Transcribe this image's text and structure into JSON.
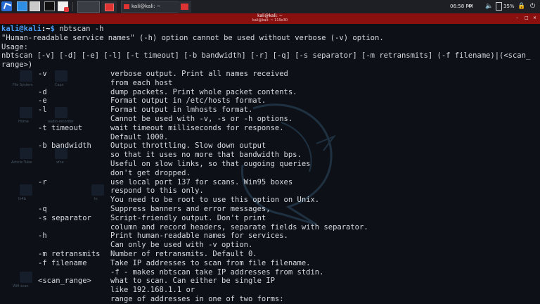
{
  "taskbar": {
    "task_label": "kali@kali: ~",
    "clock": "06:58 PM",
    "battery": "35%",
    "icons": [
      "kali-menu-icon",
      "browser-icon",
      "files-icon",
      "terminal-icon",
      "firefox-icon",
      "bell-icon",
      "volume-icon",
      "battery-icon",
      "lock-icon",
      "power-icon"
    ]
  },
  "window": {
    "title": "kali@kali: ~",
    "subtitle": "kali@kali: ~ 119x30"
  },
  "desktop_icons": [
    "File System",
    "Caps",
    "Home",
    "audio-recorder",
    "Article Tube",
    "xfce",
    "lh4b",
    "ts",
    "Wifi scan"
  ],
  "terminal": {
    "prompt_user": "kali",
    "prompt_at": "@",
    "prompt_host": "kali",
    "prompt_path": ":~",
    "prompt_dollar": "$ ",
    "command": "nbtscan -h",
    "header_lines": [
      "\"Human-readable service names\" (-h) option cannot be used without verbose (-v) option.",
      "Usage:",
      "nbtscan [-v] [-d] [-e] [-l] [-t timeout] [-b bandwidth] [-r] [-q] [-s separator] [-m retransmits] (-f filename)|(<scan_",
      "range>)"
    ],
    "options": [
      {
        "opt": "-v",
        "desc": "verbose output. Print all names received"
      },
      {
        "opt": "",
        "desc": "from each host"
      },
      {
        "opt": "-d",
        "desc": "dump packets. Print whole packet contents."
      },
      {
        "opt": "-e",
        "desc": "Format output in /etc/hosts format."
      },
      {
        "opt": "-l",
        "desc": "Format output in lmhosts format."
      },
      {
        "opt": "",
        "desc": "Cannot be used with -v, -s or -h options."
      },
      {
        "opt": "-t timeout",
        "desc": "wait timeout milliseconds for response."
      },
      {
        "opt": "",
        "desc": "Default 1000."
      },
      {
        "opt": "-b bandwidth",
        "desc": "Output throttling. Slow down output"
      },
      {
        "opt": "",
        "desc": "so that it uses no more that bandwidth bps."
      },
      {
        "opt": "",
        "desc": "Useful on slow links, so that ougoing queries"
      },
      {
        "opt": "",
        "desc": "don't get dropped."
      },
      {
        "opt": "-r",
        "desc": "use local port 137 for scans. Win95 boxes"
      },
      {
        "opt": "",
        "desc": "respond to this only."
      },
      {
        "opt": "",
        "desc": "You need to be root to use this option on Unix."
      },
      {
        "opt": "-q",
        "desc": "Suppress banners and error messages,"
      },
      {
        "opt": "-s separator",
        "desc": "Script-friendly output. Don't print"
      },
      {
        "opt": "",
        "desc": "column and record headers, separate fields with separator."
      },
      {
        "opt": "-h",
        "desc": "Print human-readable names for services."
      },
      {
        "opt": "",
        "desc": "Can only be used with -v option."
      },
      {
        "opt": "-m retransmits",
        "desc": "Number of retransmits. Default 0."
      },
      {
        "opt": "-f filename",
        "desc": "Take IP addresses to scan from file filename."
      },
      {
        "opt": "",
        "desc": "-f - makes nbtscan take IP addresses from stdin."
      },
      {
        "opt": "<scan_range>",
        "desc": "what to scan. Can either be single IP"
      },
      {
        "opt": "",
        "desc": "like 192.168.1.1 or"
      },
      {
        "opt": "",
        "desc": "range of addresses in one of two forms:"
      }
    ]
  }
}
